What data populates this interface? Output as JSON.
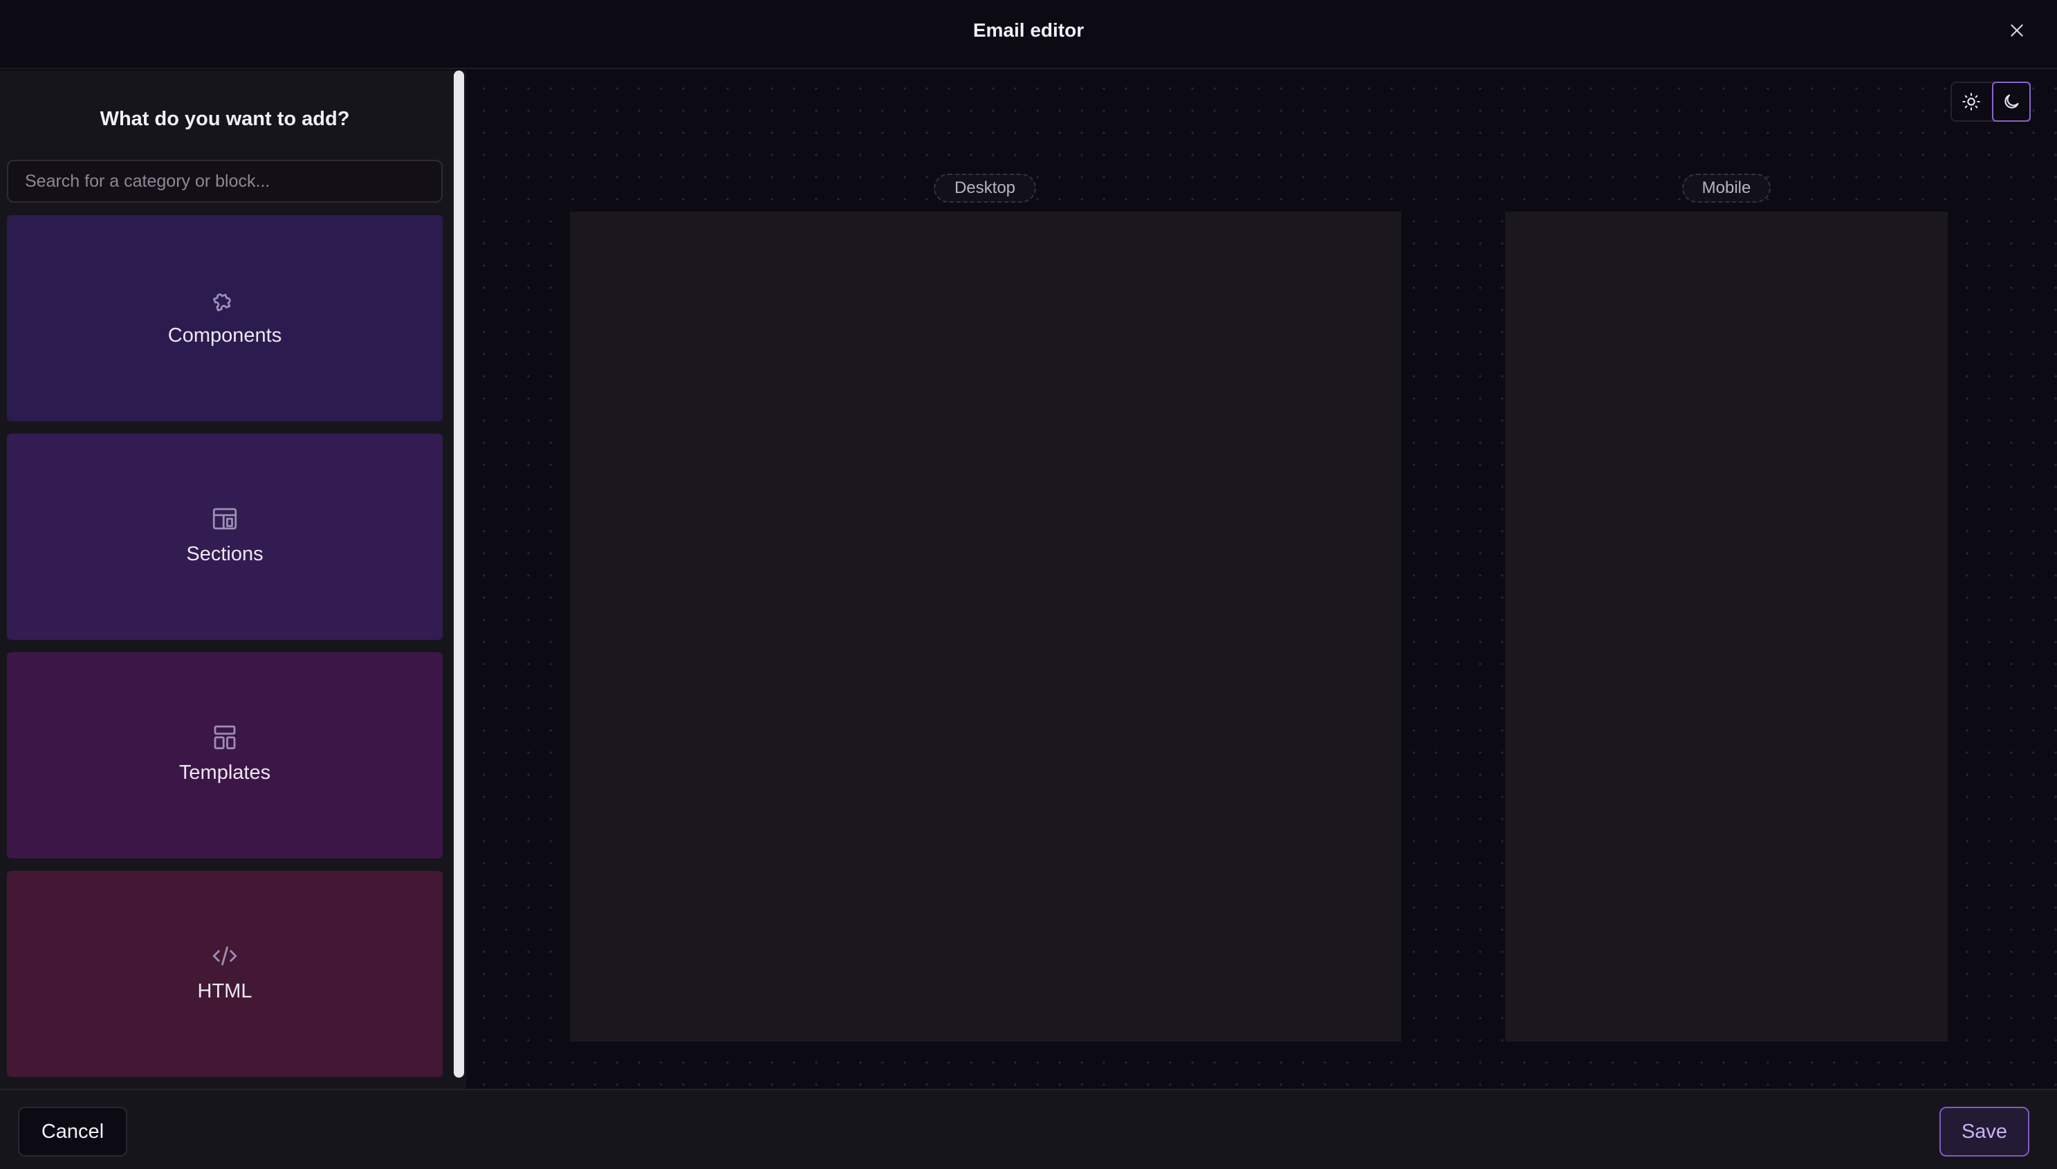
{
  "header": {
    "title": "Email editor",
    "close_icon": "close-icon"
  },
  "sidebar": {
    "heading": "What do you want to add?",
    "search_placeholder": "Search for a category or block...",
    "search_value": "",
    "categories": [
      {
        "label": "Components",
        "icon": "puzzle-icon",
        "color": "#2c1b4e"
      },
      {
        "label": "Sections",
        "icon": "layout-section-icon",
        "color": "#321c52"
      },
      {
        "label": "Templates",
        "icon": "layout-template-icon",
        "color": "#3d1648"
      },
      {
        "label": "HTML",
        "icon": "code-icon",
        "color": "#431834"
      }
    ]
  },
  "canvas": {
    "theme_toggle": {
      "options": [
        "light-theme-icon",
        "dark-theme-icon"
      ],
      "selected": "dark"
    },
    "previews": [
      {
        "label": "Desktop"
      },
      {
        "label": "Mobile"
      }
    ]
  },
  "footer": {
    "cancel_label": "Cancel",
    "save_label": "Save"
  },
  "colors": {
    "background": "#0c0a12",
    "panel": "#17151c",
    "accent": "#8a63d2",
    "save_text": "#c9b3f3"
  }
}
